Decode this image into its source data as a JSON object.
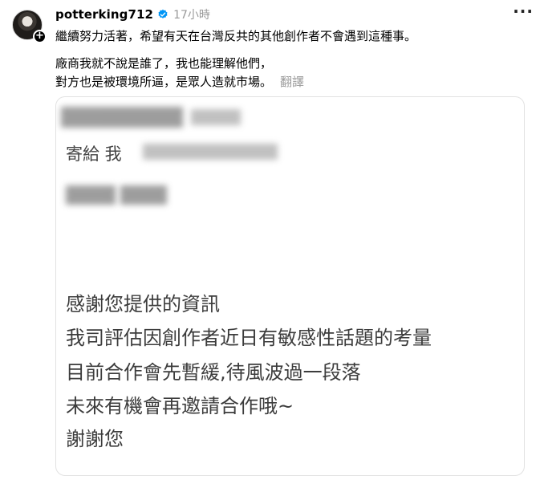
{
  "post": {
    "username": "potterking712",
    "timestamp": "17小時",
    "line1": "繼續努力活著，希望有天在台灣反共的其他創作者不會遇到這種事。",
    "line2": "廠商我就不說是誰了，我也能理解他們，",
    "line3": "對方也是被環境所逼，是眾人造就市場。",
    "translate_label": "翻譯",
    "more_icon": "more-horizontal-icon",
    "verified_icon": "verified-badge-icon"
  },
  "image": {
    "sent_to": "寄給 我",
    "messages": [
      "感謝您提供的資訊",
      "我司評估因創作者近日有敏感性話題的考量",
      "目前合作會先暫緩,待風波過一段落",
      "未來有機會再邀請合作哦~",
      "謝謝您"
    ]
  },
  "colors": {
    "verified": "#0095f6",
    "muted": "#999999",
    "message_text": "#3c3c3c"
  }
}
